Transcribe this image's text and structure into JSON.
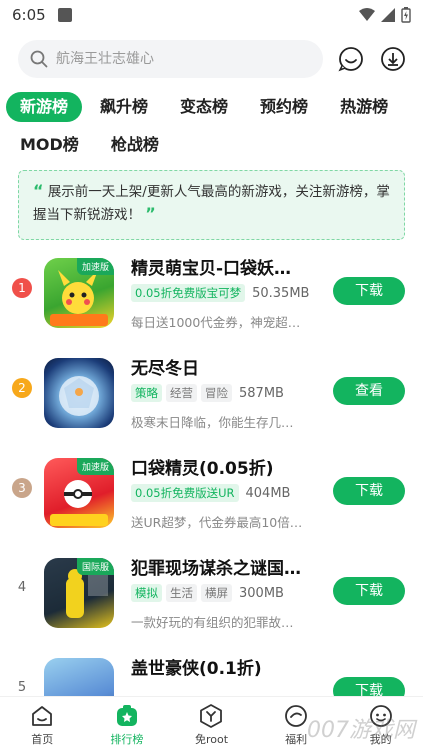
{
  "status": {
    "time": "6:05"
  },
  "search": {
    "placeholder": "航海王壮志雄心"
  },
  "tabs": {
    "row1": [
      "新游榜",
      "飙升榜",
      "变态榜",
      "预约榜",
      "热游榜"
    ],
    "row2": [
      "MOD榜",
      "枪战榜"
    ],
    "active": "新游榜"
  },
  "notice": {
    "text": "展示前一天上架/更新人气最高的新游戏，关注新游榜，掌握当下新锐游戏！"
  },
  "games": [
    {
      "rank": "1",
      "title": "精灵萌宝贝-口袋妖…",
      "corner": "加速版",
      "tags": [
        "0.05折免费版宝可梦"
      ],
      "size": "50.35MB",
      "desc": "每日送1000代金券，神宠超…",
      "button": "下载",
      "rank_color": "#f0504a"
    },
    {
      "rank": "2",
      "title": "无尽冬日",
      "corner": "",
      "tags": [
        "策略",
        "经营",
        "冒险"
      ],
      "size": "587MB",
      "desc": "极寒末日降临，你能生存几…",
      "button": "查看",
      "rank_color": "#f7a81b"
    },
    {
      "rank": "3",
      "title": "口袋精灵(0.05折)",
      "corner": "加速版",
      "tags": [
        "0.05折免费版送UR"
      ],
      "size": "404MB",
      "desc": "送UR超梦，代金券最高10倍…",
      "button": "下载",
      "rank_color": "#c9a58a"
    },
    {
      "rank": "4",
      "title": "犯罪现场谋杀之谜国…",
      "corner": "国际服",
      "tags": [
        "模拟",
        "生活",
        "横屏"
      ],
      "size": "300MB",
      "desc": "一款好玩的有组织的犯罪故…",
      "button": "下载",
      "rank_color": ""
    },
    {
      "rank": "5",
      "title": "盖世豪侠(0.1折)",
      "corner": "",
      "tags": [],
      "size": "",
      "desc": "",
      "button": "下载",
      "rank_color": ""
    }
  ],
  "nav": [
    {
      "label": "首页",
      "icon": "home-icon"
    },
    {
      "label": "排行榜",
      "icon": "ranking-icon"
    },
    {
      "label": "免root",
      "icon": "no-root-icon"
    },
    {
      "label": "福利",
      "icon": "gift-icon"
    },
    {
      "label": "我的",
      "icon": "user-icon"
    }
  ],
  "watermark": "007游戏网",
  "colors": {
    "accent": "#13b45f"
  }
}
